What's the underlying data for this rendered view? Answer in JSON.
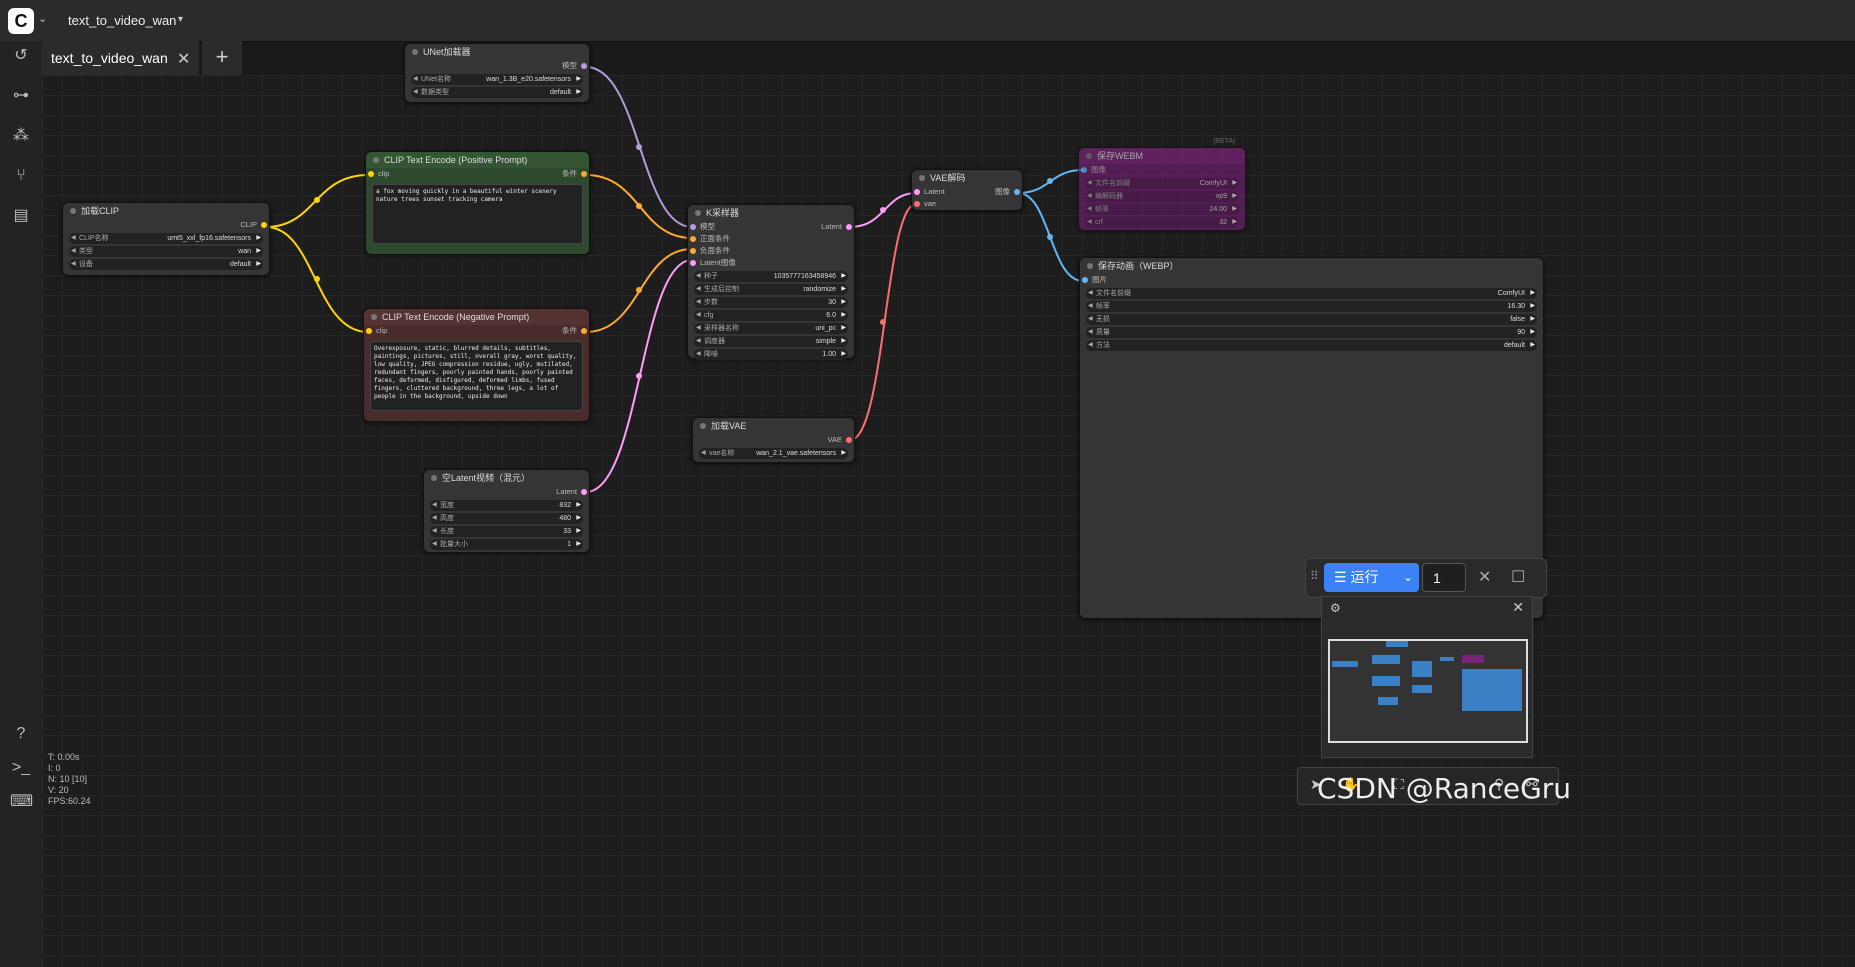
{
  "app": {
    "workflow_name": "text_to_video_wan"
  },
  "tabs": [
    {
      "label": "text_to_video_wan"
    }
  ],
  "nodes": {
    "unet": {
      "title": "UNet加载器",
      "out": "模型",
      "w1_label": "UNet名称",
      "w1_value": "wan_1.3B_e20.safetensors",
      "w2_label": "数据类型",
      "w2_value": "default"
    },
    "clip_loader": {
      "title": "加载CLIP",
      "out": "CLIP",
      "w1_label": "CLIP名称",
      "w1_value": "umt5_xxl_fp16.safetensors",
      "w2_label": "类型",
      "w2_value": "wan",
      "w3_label": "设备",
      "w3_value": "default"
    },
    "pos": {
      "title": "CLIP Text Encode (Positive Prompt)",
      "in": "clip",
      "out": "条件",
      "text": "a fox moving quickly in a beautiful winter scenery nature trees sunset tracking camera"
    },
    "neg": {
      "title": "CLIP Text Encode (Negative Prompt)",
      "in": "clip",
      "out": "条件",
      "text": "Overexposure, static, blurred details, subtitles, paintings, pictures, still, overall gray, worst quality, low quality, JPEG compression residue, ugly, mutilated, redundant fingers, poorly painted hands, poorly painted faces, deformed, disfigured, deformed limbs, fused fingers, cluttered background, three legs, a lot of people in the background, upside down"
    },
    "ksampler": {
      "title": "K采样器",
      "in1": "模型",
      "in2": "正面条件",
      "in3": "负面条件",
      "in4": "Latent图像",
      "out": "Latent",
      "widgets": [
        {
          "label": "种子",
          "value": "1035777163458946"
        },
        {
          "label": "生成后控制",
          "value": "randomize"
        },
        {
          "label": "步数",
          "value": "30"
        },
        {
          "label": "cfg",
          "value": "6.0"
        },
        {
          "label": "采样器名称",
          "value": "uni_pc"
        },
        {
          "label": "调度器",
          "value": "simple"
        },
        {
          "label": "降噪",
          "value": "1.00"
        }
      ]
    },
    "vae_decode": {
      "title": "VAE解码",
      "in1": "Latent",
      "in2": "vae",
      "out": "图像"
    },
    "vae_loader": {
      "title": "加载VAE",
      "out": "VAE",
      "w1_label": "vae名称",
      "w1_value": "wan_2.1_vae.safetensors"
    },
    "latent": {
      "title": "空Latent视频（混元）",
      "out": "Latent",
      "widgets": [
        {
          "label": "宽度",
          "value": "832"
        },
        {
          "label": "高度",
          "value": "480"
        },
        {
          "label": "长度",
          "value": "33"
        },
        {
          "label": "批量大小",
          "value": "1"
        }
      ]
    },
    "save_webm": {
      "title": "保存WEBM",
      "badge": "[BETA]",
      "in": "图像",
      "widgets": [
        {
          "label": "文件名前缀",
          "value": "ComfyUI"
        },
        {
          "label": "编解码器",
          "value": "vp9"
        },
        {
          "label": "帧率",
          "value": "24.00"
        },
        {
          "label": "crf",
          "value": "32"
        }
      ]
    },
    "save_webp": {
      "title": "保存动画（WEBP）",
      "in": "图片",
      "widgets": [
        {
          "label": "文件名前缀",
          "value": "ComfyUI"
        },
        {
          "label": "帧率",
          "value": "16.30"
        },
        {
          "label": "无损",
          "value": "false"
        },
        {
          "label": "质量",
          "value": "90"
        },
        {
          "label": "方法",
          "value": "default"
        }
      ]
    }
  },
  "stats": {
    "t": "T: 0.00s",
    "i": "I: 0",
    "n": "N: 10 [10]",
    "v": "V: 20",
    "fps": "FPS:60.24"
  },
  "run": {
    "label": "运行",
    "count": "1"
  },
  "watermark": "CSDN @RanceGru",
  "colors": {
    "accent": "#3b82f6",
    "clip": "#ffd500",
    "model": "#b39ddb",
    "cond": "#ffa931",
    "latent": "#ff9cf9",
    "vae": "#ff6e6e",
    "image": "#64b5f6"
  }
}
